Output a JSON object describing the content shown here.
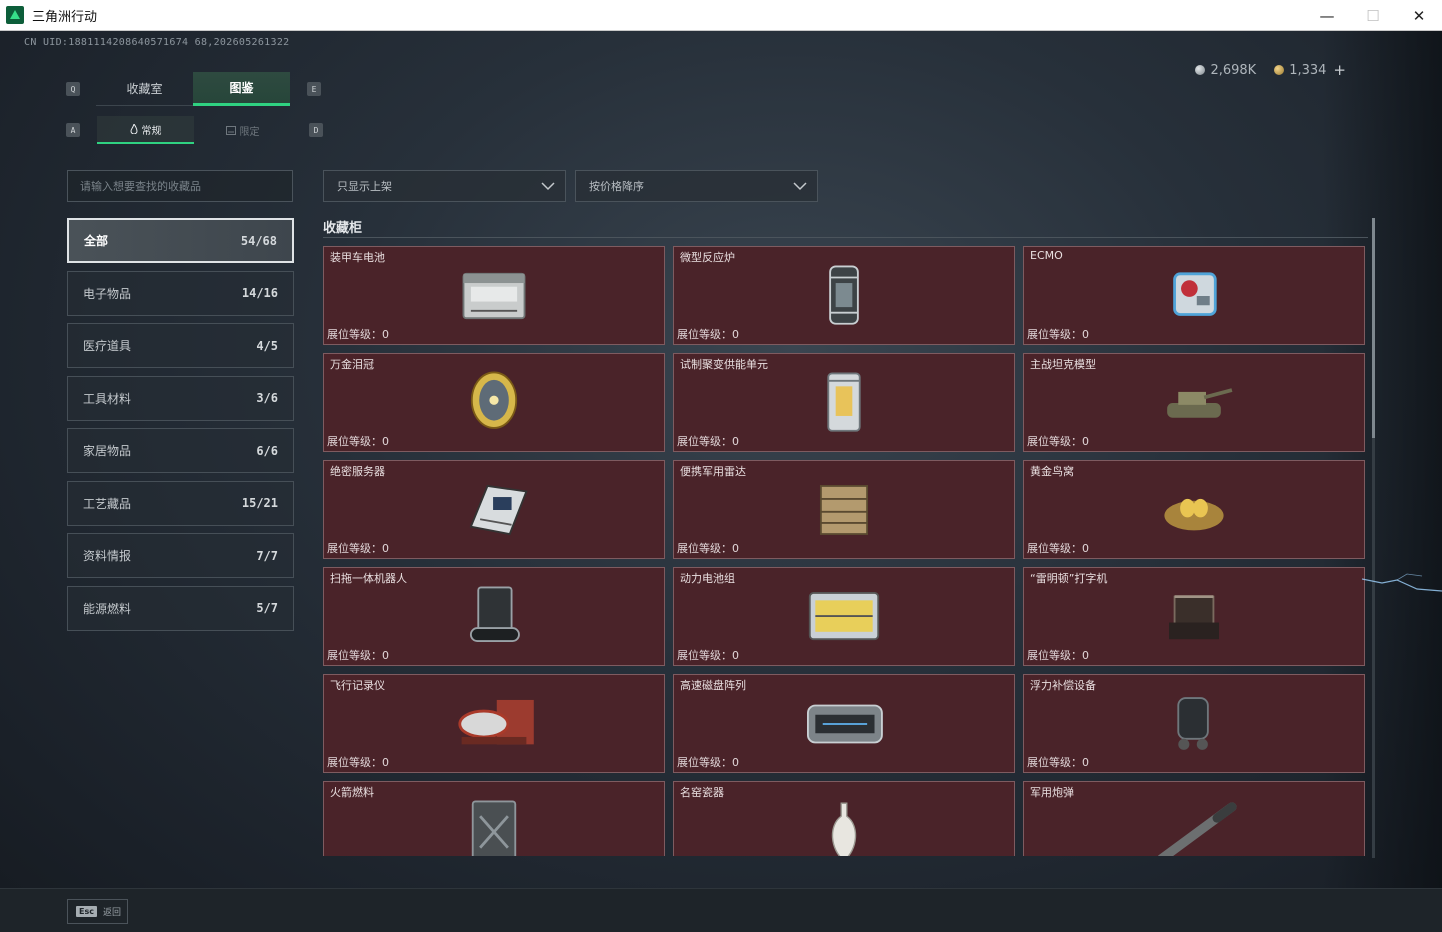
{
  "window": {
    "title": "三角洲行动",
    "controls": {
      "minimize": "—",
      "maximize": "☐",
      "close": "✕"
    }
  },
  "uid": "CN UID:1881114208640571674 68,202605261322",
  "currency": {
    "silver": "2,698K",
    "gold": "1,334",
    "plus": "+"
  },
  "key_hints": {
    "tab_left": "Q",
    "tab_right": "E",
    "sub_left": "A",
    "sub_right": "D"
  },
  "main_tabs": [
    {
      "label": "收藏室",
      "active": false
    },
    {
      "label": "图鉴",
      "active": true
    }
  ],
  "sub_tabs": [
    {
      "label": "常规",
      "icon": "flame-icon",
      "active": true
    },
    {
      "label": "限定",
      "icon": "frame-icon",
      "active": false
    }
  ],
  "search": {
    "placeholder": "请输入想要查找的收藏品"
  },
  "categories": [
    {
      "label": "全部",
      "count": "54/68",
      "active": true
    },
    {
      "label": "电子物品",
      "count": "14/16"
    },
    {
      "label": "医疗道具",
      "count": "4/5"
    },
    {
      "label": "工具材料",
      "count": "3/6"
    },
    {
      "label": "家居物品",
      "count": "6/6"
    },
    {
      "label": "工艺藏品",
      "count": "15/21"
    },
    {
      "label": "资料情报",
      "count": "7/7"
    },
    {
      "label": "能源燃料",
      "count": "5/7"
    }
  ],
  "filters": {
    "shelf": "只显示上架",
    "sort": "按价格降序"
  },
  "section_title": "收藏柜",
  "level_label": "展位等级：0",
  "items": [
    {
      "name": "装甲车电池",
      "icon": "battery-icon"
    },
    {
      "name": "微型反应炉",
      "icon": "reactor-icon"
    },
    {
      "name": "ECMO",
      "icon": "ecmo-icon"
    },
    {
      "name": "万金泪冠",
      "icon": "jeweled-egg-icon"
    },
    {
      "name": "试制聚变供能单元",
      "icon": "fusion-cell-icon"
    },
    {
      "name": "主战坦克模型",
      "icon": "tank-model-icon"
    },
    {
      "name": "绝密服务器",
      "icon": "server-icon"
    },
    {
      "name": "便携军用雷达",
      "icon": "radar-icon"
    },
    {
      "name": "黄金鸟窝",
      "icon": "golden-nest-icon"
    },
    {
      "name": "扫拖一体机器人",
      "icon": "robot-vacuum-icon"
    },
    {
      "name": "动力电池组",
      "icon": "battery-pack-icon"
    },
    {
      "name": "“雷明顿”打字机",
      "icon": "typewriter-icon"
    },
    {
      "name": "飞行记录仪",
      "icon": "flight-recorder-icon"
    },
    {
      "name": "高速磁盘阵列",
      "icon": "disk-array-icon"
    },
    {
      "name": "浮力补偿设备",
      "icon": "buoyancy-device-icon"
    },
    {
      "name": "火箭燃料",
      "icon": "fuel-can-icon"
    },
    {
      "name": "名窑瓷器",
      "icon": "porcelain-vase-icon"
    },
    {
      "name": "军用炮弹",
      "icon": "artillery-shell-icon"
    }
  ],
  "footer": {
    "esc_key": "Esc",
    "back_label": "返回"
  },
  "colors": {
    "accent": "#2fd281",
    "card_bg": "#4a2329",
    "card_border": "#7e5b60"
  }
}
